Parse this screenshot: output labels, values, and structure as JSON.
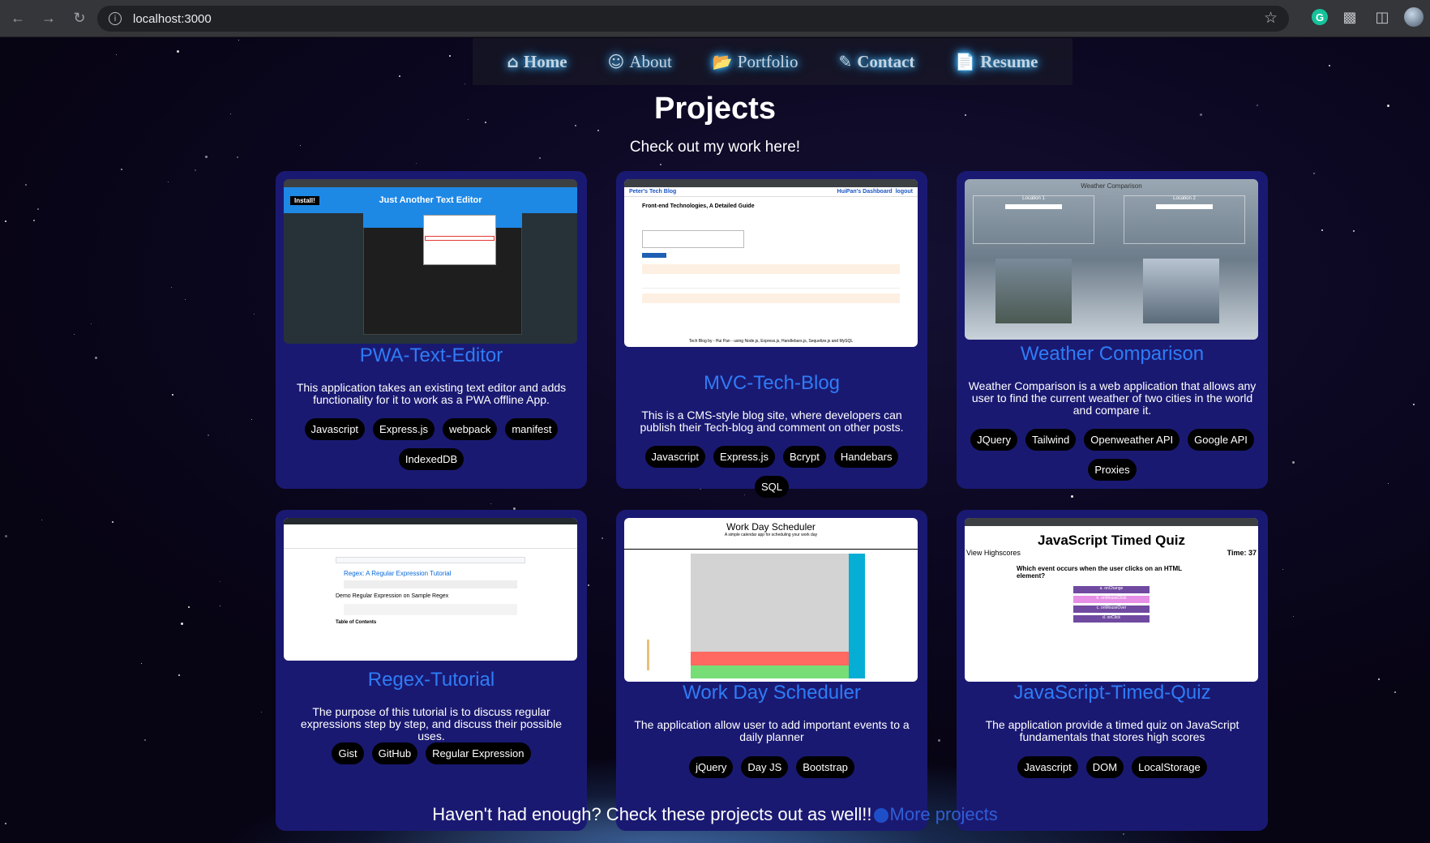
{
  "browser": {
    "url": "localhost:3000",
    "back_icon": "back-arrow-icon",
    "forward_icon": "forward-arrow-icon",
    "reload_icon": "reload-icon"
  },
  "nav": {
    "items": [
      {
        "label": "Home",
        "icon": "home-icon"
      },
      {
        "label": "About",
        "icon": "user-icon"
      },
      {
        "label": "Portfolio",
        "icon": "folder-open-icon"
      },
      {
        "label": "Contact",
        "icon": "edit-icon"
      },
      {
        "label": "Resume",
        "icon": "file-icon"
      }
    ]
  },
  "header": {
    "title": "Projects",
    "subtitle": "Check out my work here!"
  },
  "projects": [
    {
      "title": "PWA-Text-Editor",
      "description": "This application takes an existing text editor and adds functionality for it to work as a PWA offline App.",
      "tags": [
        "Javascript",
        "Express.js",
        "webpack",
        "manifest",
        "IndexedDB"
      ],
      "thumb": {
        "heading": "Just Another Text Editor",
        "button": "Install!"
      }
    },
    {
      "title": "MVC-Tech-Blog",
      "description": "This is a CMS-style blog site, where developers can publish their Tech-blog and comment on other posts.",
      "tags": [
        "Javascript",
        "Express.js",
        "Bcrypt",
        "Handebars",
        "SQL"
      ],
      "thumb": {
        "site": "Peter's Tech Blog",
        "dashboard": "HuiPan's Dashboard",
        "logout": "logout",
        "post": "Front-end Technologies, A Detailed Guide",
        "footer": "Tech Blog by - Hui Pan - using Node.js, Express.js, Handlebars.js, Sequelize.js and MySQL"
      }
    },
    {
      "title": "Weather Comparison",
      "description": "Weather Comparison is a web application that allows any user to find the current weather of two cities in the world and compare it.",
      "tags": [
        "JQuery",
        "Tailwind",
        "Openweather API",
        "Google API",
        "Proxies"
      ],
      "thumb": {
        "heading": "Weather Comparison",
        "loc1": "Location 1",
        "loc2": "Location 2"
      }
    },
    {
      "title": "Regex-Tutorial",
      "description": "The purpose of this tutorial is to discuss regular expressions step by step, and discuss their possible uses.",
      "tags": [
        "Gist",
        "GitHub",
        "Regular Expression"
      ],
      "thumb": {
        "heading": "Regex: A Regular Expression Tutorial",
        "sub": "Demo Regular Expression on Sample Regex",
        "toc": "Table of Contents"
      }
    },
    {
      "title": "Work Day Scheduler",
      "description": "The application allow user to add important events to a daily planner",
      "tags": [
        "jQuery",
        "Day JS",
        "Bootstrap"
      ],
      "thumb": {
        "heading": "Work Day Scheduler",
        "sub": "A simple calendar app for scheduling your work day"
      }
    },
    {
      "title": "JavaScript-Timed-Quiz",
      "description": "The application provide a timed quiz on JavaScript fundamentals that stores high scores",
      "tags": [
        "Javascript",
        "DOM",
        "LocalStorage"
      ],
      "thumb": {
        "heading": "JavaScript Timed Quiz",
        "highscores": "View Highscores",
        "time": "Time: 37",
        "question": "Which event occurs when the user clicks on an HTML element?",
        "options": [
          "a. onChange",
          "b. onMouseClick",
          "c. onMouseOver",
          "d. onClick"
        ]
      }
    }
  ],
  "footer": {
    "text": "Haven't had enough? Check these projects out as well!!",
    "link": "More projects"
  },
  "colors": {
    "card_bg": "#1a1972",
    "title_link": "#2f7cf6",
    "nav_glow": "#4ac1ff"
  }
}
